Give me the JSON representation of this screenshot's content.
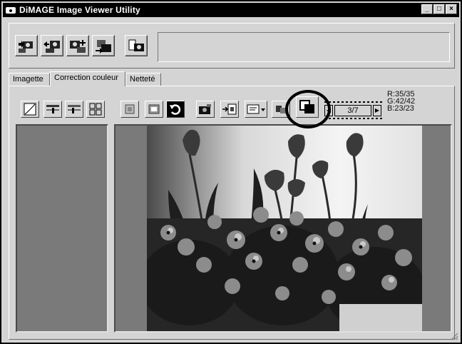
{
  "window": {
    "title": "DiMAGE Image Viewer Utility",
    "controls": {
      "minimize": "_",
      "maximize": "□",
      "close": "×"
    }
  },
  "toolbar": {
    "buttons": [
      {
        "icon": "camera-load-icon"
      },
      {
        "icon": "camera-save-icon"
      },
      {
        "icon": "camera-settings-icon"
      },
      {
        "icon": "camera-transfer-icon"
      },
      {
        "icon": "camera-info-icon"
      }
    ],
    "status_text": ""
  },
  "tabs": [
    {
      "label": "Imagette",
      "active": false
    },
    {
      "label": "Correction couleur",
      "active": true
    },
    {
      "label": "Netteté",
      "active": false
    }
  ],
  "correction_toolbar": {
    "buttons": [
      {
        "icon": "tone-curve-icon"
      },
      {
        "icon": "brightness-contrast-icon"
      },
      {
        "icon": "color-balance-icon"
      },
      {
        "icon": "variations-grid-icon"
      },
      {
        "icon": "undo-frame-icon"
      },
      {
        "icon": "reset-frame-icon"
      },
      {
        "icon": "undo-icon"
      },
      {
        "icon": "camera-snapshot-icon"
      },
      {
        "icon": "apply-arrow-icon"
      },
      {
        "icon": "options-dropdown-icon"
      },
      {
        "icon": "small-compare-icon"
      },
      {
        "icon": "before-after-compare-icon"
      }
    ],
    "frame_counter": "3/7",
    "nav_prev": "◀",
    "nav_next": "▶",
    "rgb_readout": {
      "r": "R:35/35",
      "g": "G:42/42",
      "b": "B:23/23"
    }
  },
  "colors": {
    "window_bg": "#d4d4d4",
    "pane_bg": "#7a7a7a",
    "titlebar": "#000000"
  }
}
